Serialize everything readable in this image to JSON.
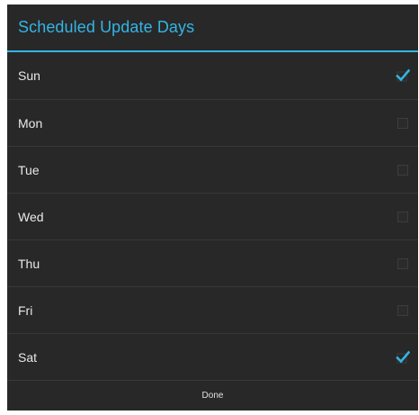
{
  "dialog": {
    "title": "Scheduled Update Days",
    "accent_color": "#33b5e5",
    "items": [
      {
        "label": "Sun",
        "checked": true
      },
      {
        "label": "Mon",
        "checked": false
      },
      {
        "label": "Tue",
        "checked": false
      },
      {
        "label": "Wed",
        "checked": false
      },
      {
        "label": "Thu",
        "checked": false
      },
      {
        "label": "Fri",
        "checked": false
      },
      {
        "label": "Sat",
        "checked": true
      }
    ],
    "done_label": "Done"
  }
}
